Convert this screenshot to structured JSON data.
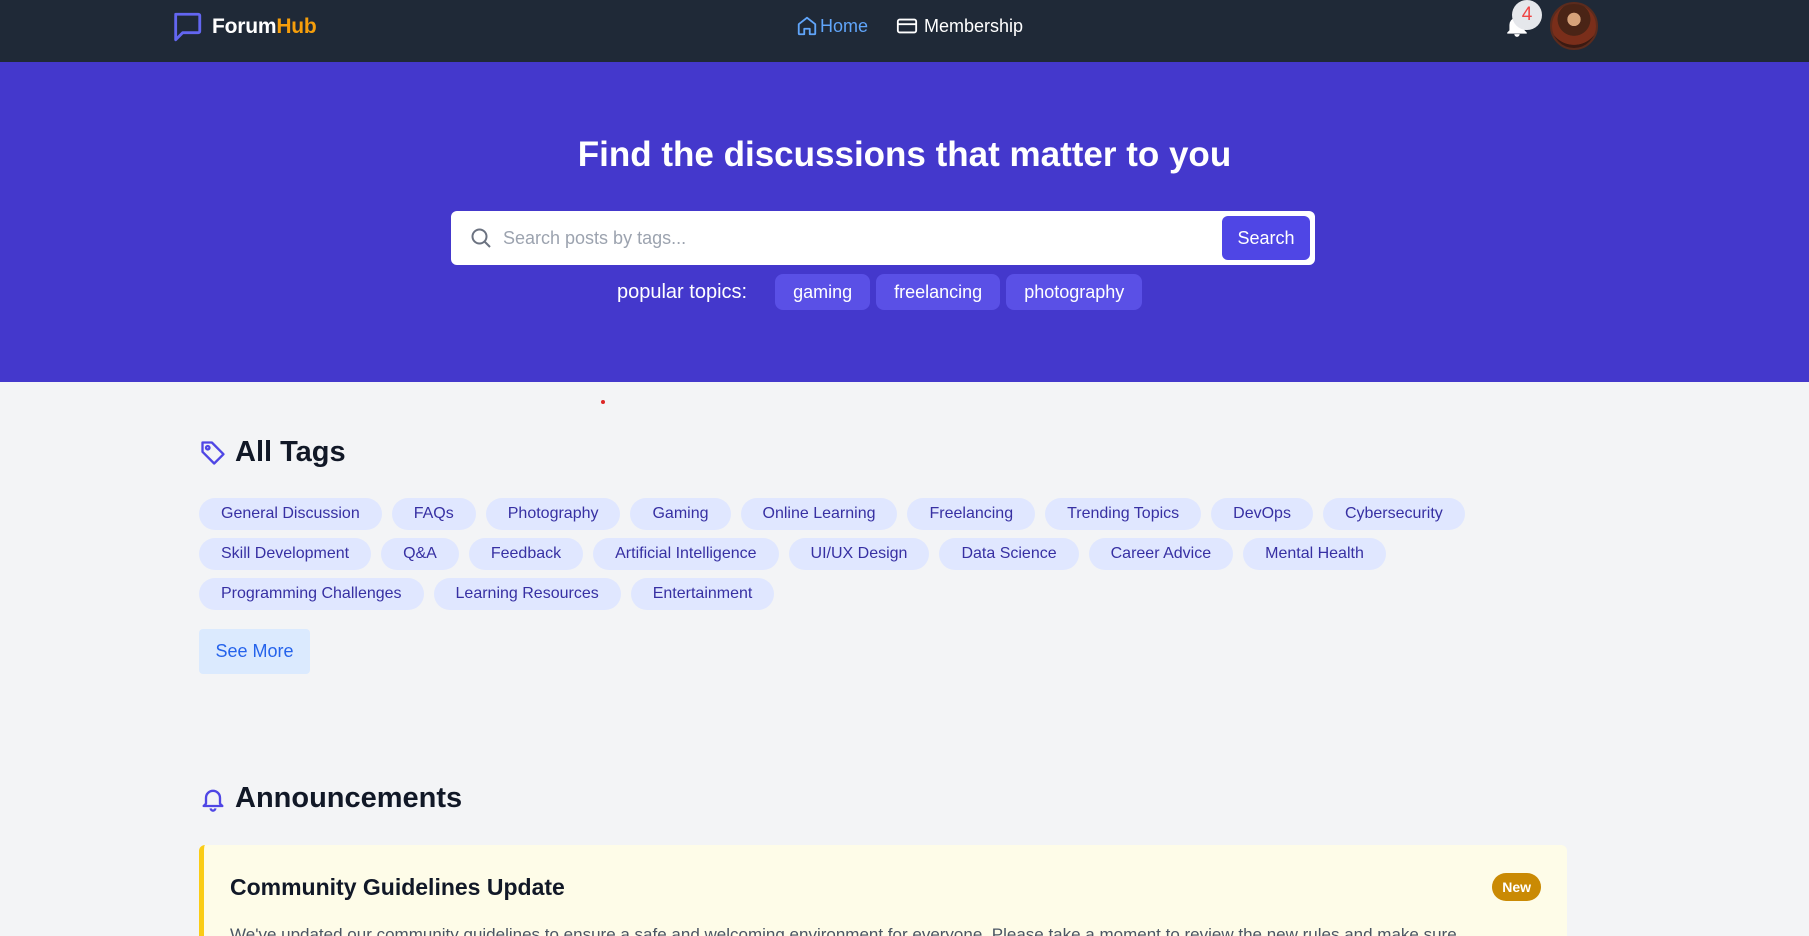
{
  "navbar": {
    "logo_part1": "Forum",
    "logo_part2": "Hub",
    "home_label": "Home",
    "membership_label": "Membership",
    "notification_count": "4"
  },
  "hero": {
    "title": "Find the discussions that matter to you",
    "search_placeholder": "Search posts by tags...",
    "search_button": "Search",
    "popular_label": "popular topics:",
    "popular_topics": [
      "gaming",
      "freelancing",
      "photography"
    ]
  },
  "tags": {
    "title": "All Tags",
    "rows": [
      [
        "General Discussion",
        "FAQs",
        "Photography",
        "Gaming",
        "Online Learning",
        "Freelancing",
        "Trending Topics",
        "DevOps",
        "Cybersecurity"
      ],
      [
        "Skill Development",
        "Q&A",
        "Feedback",
        "Artificial Intelligence",
        "UI/UX Design",
        "Data Science",
        "Career Advice",
        "Mental Health"
      ],
      [
        "Programming Challenges",
        "Learning Resources",
        "Entertainment"
      ]
    ],
    "see_more": "See More"
  },
  "announcements": {
    "title": "Announcements",
    "items": [
      {
        "title": "Community Guidelines Update",
        "badge": "New",
        "body": "We've updated our community guidelines to ensure a safe and welcoming environment for everyone. Please take a moment to review the new rules and make sure"
      }
    ]
  },
  "colors": {
    "navbar_bg": "#1f2937",
    "hero_bg": "#4438cc",
    "accent": "#4f46e5",
    "logo_accent": "#f59e0b",
    "tag_bg": "#e0e7ff",
    "announcement_bg": "#fefce8",
    "badge_bg": "#ca8a04"
  }
}
